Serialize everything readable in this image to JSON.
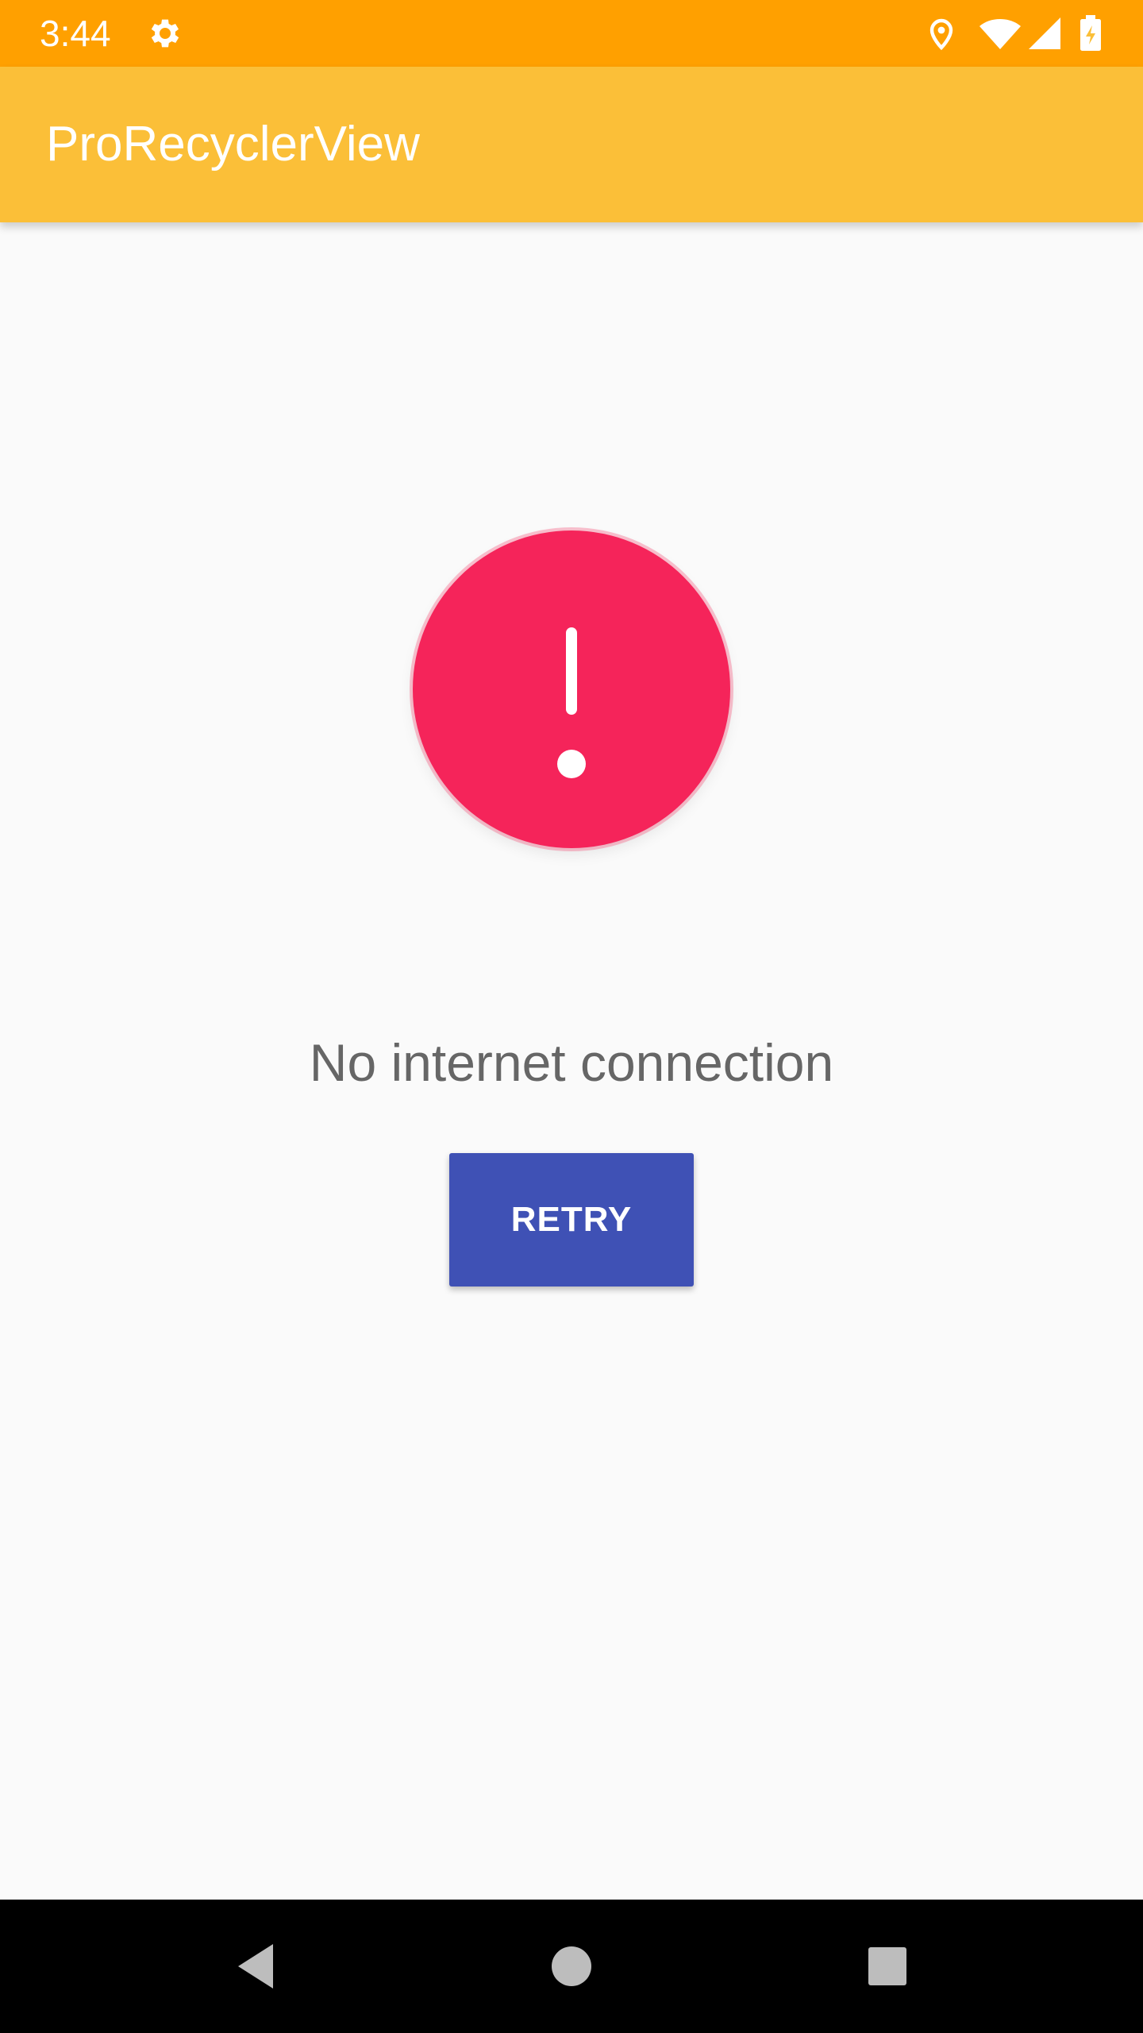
{
  "status_bar": {
    "time": "3:44",
    "icons": [
      "settings-icon",
      "location-icon",
      "wifi-icon",
      "signal-icon",
      "battery-charging-icon"
    ]
  },
  "app_bar": {
    "title": "ProRecyclerView"
  },
  "content": {
    "error_icon": "alert-icon",
    "message": "No internet connection",
    "retry_label": "RETRY"
  },
  "nav_bar": {
    "buttons": [
      "back-icon",
      "home-icon",
      "recents-icon"
    ]
  },
  "colors": {
    "status_bar": "#ffa000",
    "app_bar": "#fbbf38",
    "error": "#f5245a",
    "button": "#3f51b5",
    "message_text": "#666666"
  }
}
